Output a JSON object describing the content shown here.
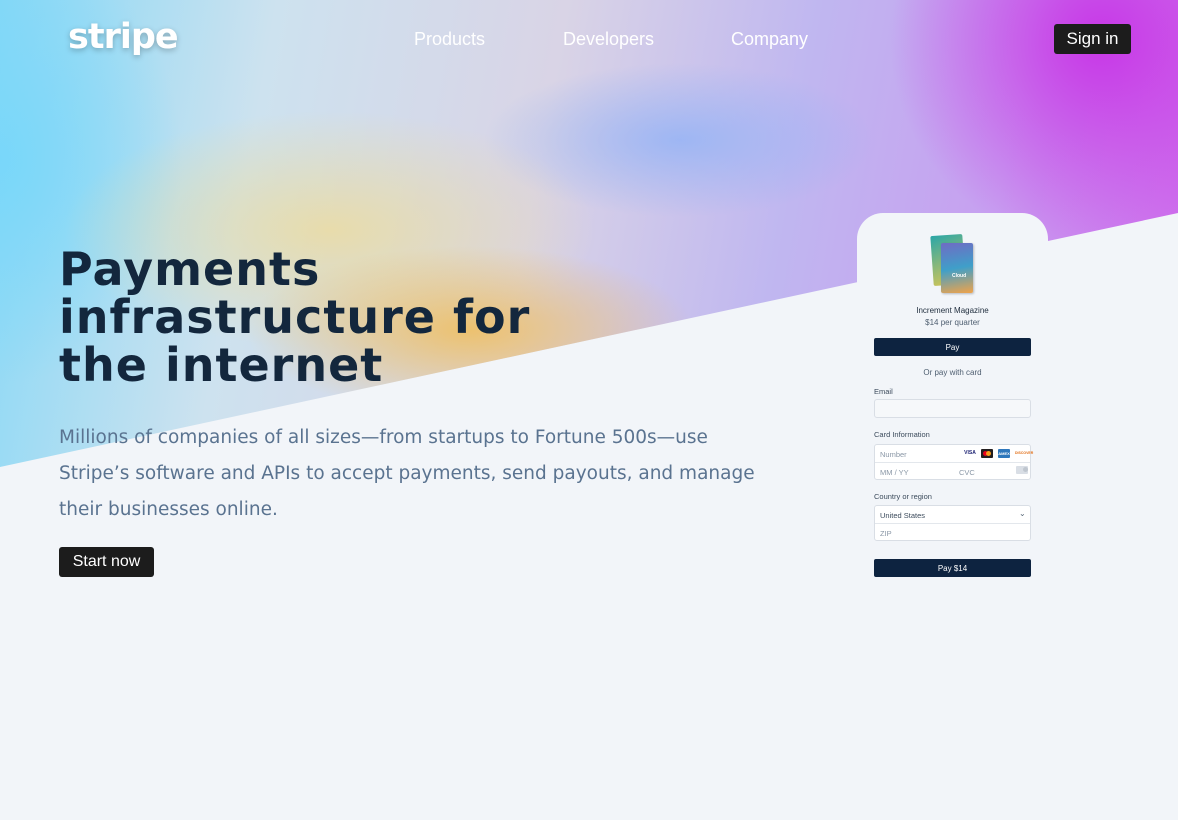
{
  "nav": {
    "logo": "stripe",
    "links": [
      "Products",
      "Developers",
      "Company"
    ],
    "sign_in": "Sign in"
  },
  "hero": {
    "headline_lines": [
      "Payments",
      "infrastructure for",
      "the internet"
    ],
    "subcopy": "Millions of companies of all sizes—from startups to Fortune 500s—use Stripe’s software and APIs to accept payments, send payouts, and manage their businesses online.",
    "cta": "Start now"
  },
  "checkout": {
    "product_name": "Increment Magazine",
    "product_price": "$14 per quarter",
    "magazine_tag": "Cloud",
    "apple_pay": " Pay",
    "or_pay": "Or pay with card",
    "email_label": "Email",
    "card_label": "Card Information",
    "card_placeholders": {
      "number": "Number",
      "expiry": "MM / YY",
      "cvc": "CVC"
    },
    "card_brands": {
      "visa": "VISA",
      "amex": "AMEX",
      "discover": "DISCOVER"
    },
    "country_label": "Country or region",
    "country_value": "United States",
    "zip_placeholder": "ZIP",
    "pay_button": "Pay $14"
  },
  "colors": {
    "headline": "#13273d",
    "subcopy": "#5a7390",
    "dark_button": "#1c1c1c",
    "navy_button": "#0d2340",
    "page_bg": "#f2f5f9"
  }
}
